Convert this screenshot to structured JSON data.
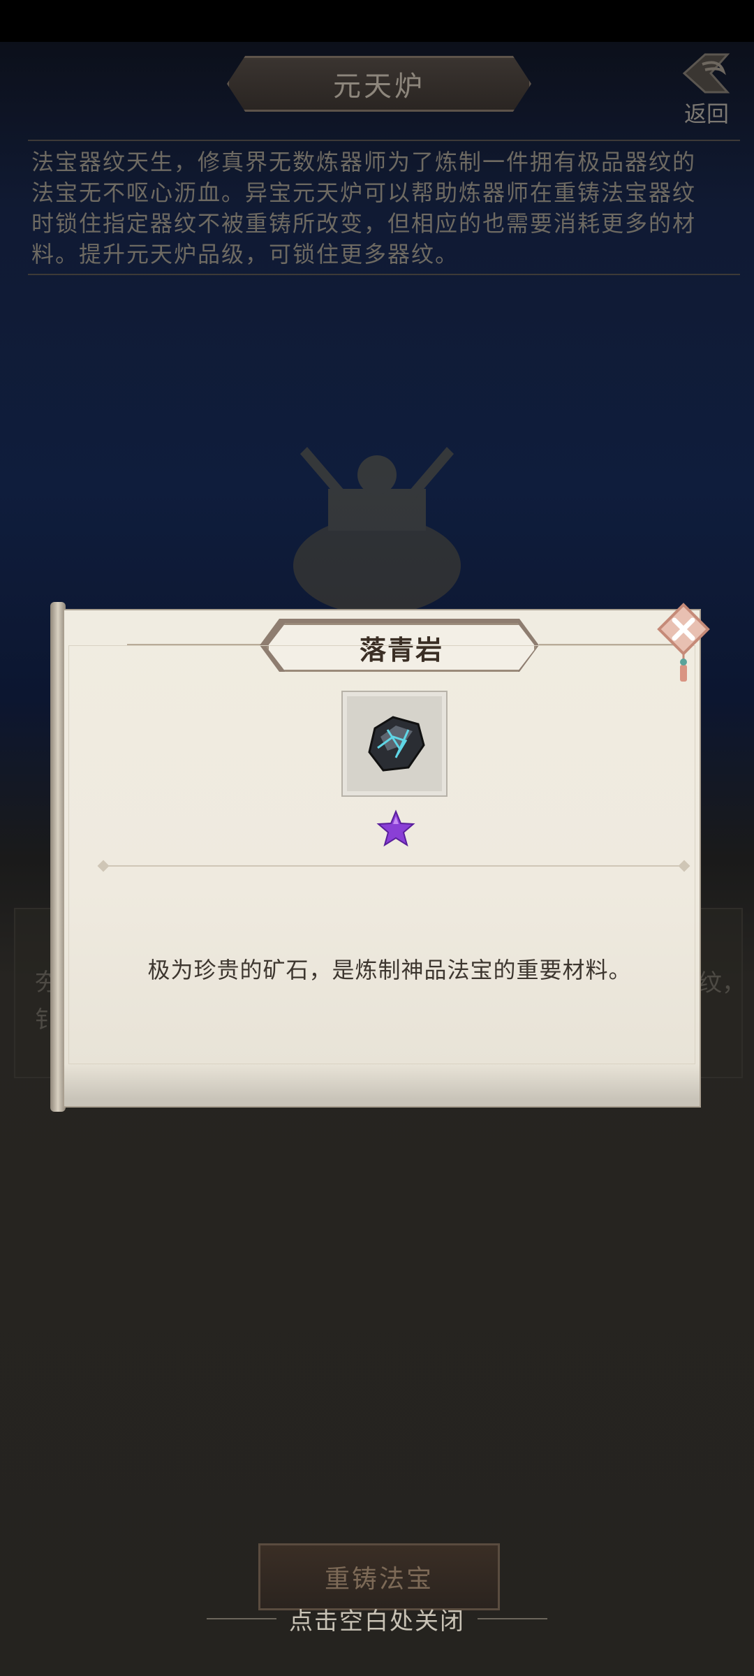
{
  "header": {
    "title": "元天炉",
    "back_label": "返回"
  },
  "intro": {
    "text": "法宝器纹天生，修真界无数炼器师为了炼制一件拥有极品器纹的法宝无不呕心沥血。异宝元天炉可以帮助炼器师在重铸法宝器纹时锁住指定器纹不被重铸所改变，但相应的也需要消耗更多的材料。提升元天炉品级，可锁住更多器纹。"
  },
  "background": {
    "left_glyph_1": "夯",
    "left_glyph_2": "钅",
    "right_glyph": "纹，"
  },
  "item_dialog": {
    "name": "落青岩",
    "rarity_stars": 1,
    "star_color": "#8a3fd6",
    "icon": "ore-rock-icon",
    "description": "极为珍贵的矿石，是炼制神品法宝的重要材料。"
  },
  "footer": {
    "reforge_label": "重铸法宝",
    "close_hint": "点击空白处关闭"
  },
  "colors": {
    "dialog_paper": "#efeadf",
    "title_banner_border": "#8e7d70",
    "close_diamond": "#e3b3a6"
  }
}
